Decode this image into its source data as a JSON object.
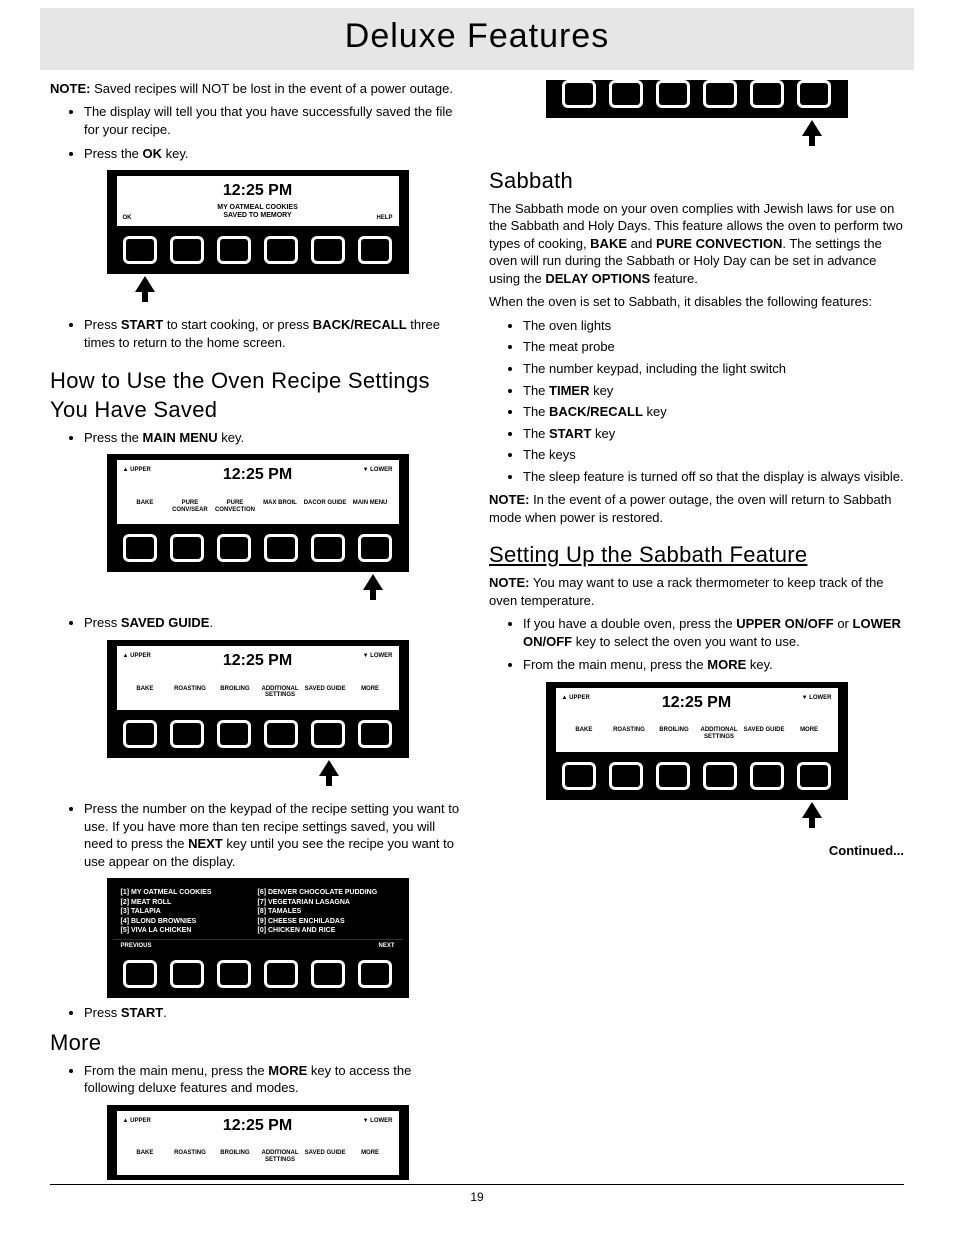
{
  "page": {
    "title": "Deluxe Features",
    "number": "19",
    "continued": "Continued..."
  },
  "intro": {
    "note_label": "NOTE:",
    "note_text": " Saved recipes will NOT be lost in the event of a power outage.",
    "bullets": [
      "The display will tell you that you have successfully saved the file for your recipe.",
      "Press the "
    ],
    "ok_key": "OK",
    "key_suffix": " key."
  },
  "panel1": {
    "time": "12:25 PM",
    "msg_l1": "MY OATMEAL COOKIES",
    "msg_l2": "SAVED TO MEMORY",
    "left": "OK",
    "right": "HELP"
  },
  "after_panel1": {
    "text_a": "Press ",
    "start": "START",
    "text_b": " to start cooking, or press ",
    "back": "BACK/RECALL",
    "text_c": " three times to return to the home screen."
  },
  "h_saved": "How to Use the Oven Recipe Settings You Have Saved",
  "saved_steps": {
    "b1a": "Press the ",
    "b1b": "MAIN MENU",
    "b1c": " key.",
    "b2a": "Press ",
    "b2b": "SAVED GUIDE",
    "b2c": ".",
    "b3a": "Press the number on the keypad of the recipe setting you want to use. If you have more than ten recipe settings saved, you will need to press the ",
    "b3b": "NEXT",
    "b3c": " key until you see the recipe you want to use appear on the display.",
    "b4a": "Press ",
    "b4b": "START",
    "b4c": "."
  },
  "panel_menu": {
    "time": "12:25 PM",
    "upper": "▲ UPPER",
    "lower": "▼ LOWER",
    "labels": [
      "BAKE",
      "PURE CONV/SEAR",
      "PURE CONVECTION",
      "MAX BROIL",
      "DACOR GUIDE",
      "MAIN MENU"
    ]
  },
  "panel_more": {
    "time": "12:25 PM",
    "upper": "▲ UPPER",
    "lower": "▼ LOWER",
    "labels": [
      "BAKE",
      "ROASTING",
      "BROILING",
      "ADDITIONAL SETTINGS",
      "SAVED GUIDE",
      "MORE"
    ]
  },
  "panel_recipes": {
    "colA": [
      "[1] MY OATMEAL COOKIES",
      "[2] MEAT ROLL",
      "[3] TALAPIA",
      "[4] BLOND BROWNIES",
      "[5] VIVA LA CHICKEN"
    ],
    "colB": [
      "[6] DENVER CHOCOLATE PUDDING",
      "[7] VEGETARIAN LASAGNA",
      "[8] TAMALES",
      "[9] CHEESE ENCHILADAS",
      "[0] CHICKEN AND RICE"
    ],
    "prev": "PREVIOUS",
    "next": "NEXT"
  },
  "h_more": "More",
  "more_steps": {
    "b1a": "From the main menu, press the ",
    "b1b": "MORE",
    "b1c": " key to access the following deluxe features and modes."
  },
  "h_sabbath": "Sabbath",
  "sabbath_para1a": "The Sabbath mode on your oven complies with Jewish laws for use on the Sabbath and Holy Days. This feature allows the oven to perform two types of cooking, ",
  "sabbath_bake": "BAKE",
  "sabbath_and": " and ",
  "sabbath_pc": "PURE CONVECTION",
  "sabbath_para1b": ". The settings the oven will run during the Sabbath or Holy Day can be set in advance using the ",
  "sabbath_delay": "DELAY OPTIONS",
  "sabbath_para1c": " feature.",
  "sabbath_para2": "When the oven is set to Sabbath, it disables the following features:",
  "sabbath_list": {
    "i1": "The oven lights",
    "i2": "The meat probe",
    "i3": "The number keypad, including the light switch",
    "i4a": "The ",
    "i4b": "TIMER",
    "i4c": " key",
    "i5a": "The ",
    "i5b": "BACK/RECALL",
    "i5c": " key",
    "i6a": "The ",
    "i6b": "START",
    "i6c": " key",
    "i7": "The keys",
    "i8": "The sleep feature is turned off so that the display is always visible."
  },
  "sabbath_note_label": "NOTE:",
  "sabbath_note": " In the event of a power outage, the oven will return to Sabbath mode when power is restored.",
  "h_setup": "Setting Up the Sabbath Feature",
  "setup_note_label": "NOTE:",
  "setup_note": " You may want to use a rack thermometer to keep track of the oven temperature.",
  "setup_steps": {
    "b1a": "If you have a double oven, press the ",
    "b1b": "UPPER ON/OFF",
    "b1c": " or ",
    "b1d": "LOWER ON/OFF",
    "b1e": " key to select the oven you want to use.",
    "b2a": "From the main menu, press the ",
    "b2b": "MORE",
    "b2c": " key."
  }
}
